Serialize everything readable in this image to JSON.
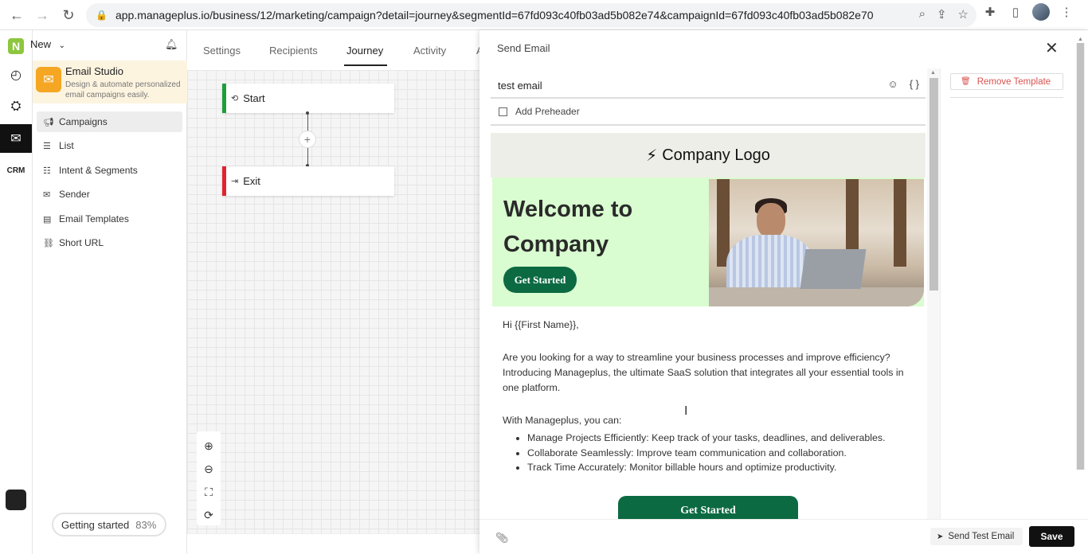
{
  "browser": {
    "url": "app.manageplus.io/business/12/marketing/campaign?detail=journey&segmentId=67fd093c40fb03ad5b082e74&campaignId=67fd093c40fb03ad5b082e70"
  },
  "sidebar": {
    "new_label": "New",
    "studio": {
      "title": "Email Studio",
      "description": "Design & automate personalized email campaigns easily."
    },
    "items": [
      {
        "label": "Campaigns",
        "icon": "megaphone-icon"
      },
      {
        "label": "List",
        "icon": "list-icon"
      },
      {
        "label": "Intent & Segments",
        "icon": "segments-icon"
      },
      {
        "label": "Sender",
        "icon": "sender-icon"
      },
      {
        "label": "Email Templates",
        "icon": "template-icon"
      },
      {
        "label": "Short URL",
        "icon": "link-icon"
      }
    ],
    "getting_started": {
      "label": "Getting started",
      "percent": "83%"
    }
  },
  "tabs": {
    "settings": "Settings",
    "recipients": "Recipients",
    "journey": "Journey",
    "activity": "Activity",
    "cut": "A"
  },
  "journey": {
    "start": "Start",
    "exit": "Exit",
    "start_color": "#1e9e3a",
    "exit_color": "#e0232e"
  },
  "panel": {
    "title": "Send Email",
    "subject": "test email",
    "preheader_label": "Add Preheader",
    "remove_template": "Remove Template",
    "send_test": "Send Test Email",
    "save": "Save"
  },
  "email": {
    "logo_text": "Company Logo",
    "hero_title": "Welcome to Company",
    "hero_button": "Get Started",
    "greeting": "Hi {{First Name}},",
    "paragraph": "Are you looking for a way to streamline your business processes and improve efficiency? Introducing Manageplus, the ultimate SaaS solution that integrates all your essential tools in one platform.",
    "list_intro": "With Manageplus, you can:",
    "bullets": [
      "Manage Projects Efficiently: Keep track of your tasks, deadlines, and deliverables.",
      "Collaborate Seamlessly: Improve team communication and collaboration.",
      "Track Time Accurately: Monitor billable hours and optimize productivity."
    ],
    "cta": "Get Started",
    "brand_green": "#0c6a42",
    "hero_bg": "#d9fcd0"
  }
}
